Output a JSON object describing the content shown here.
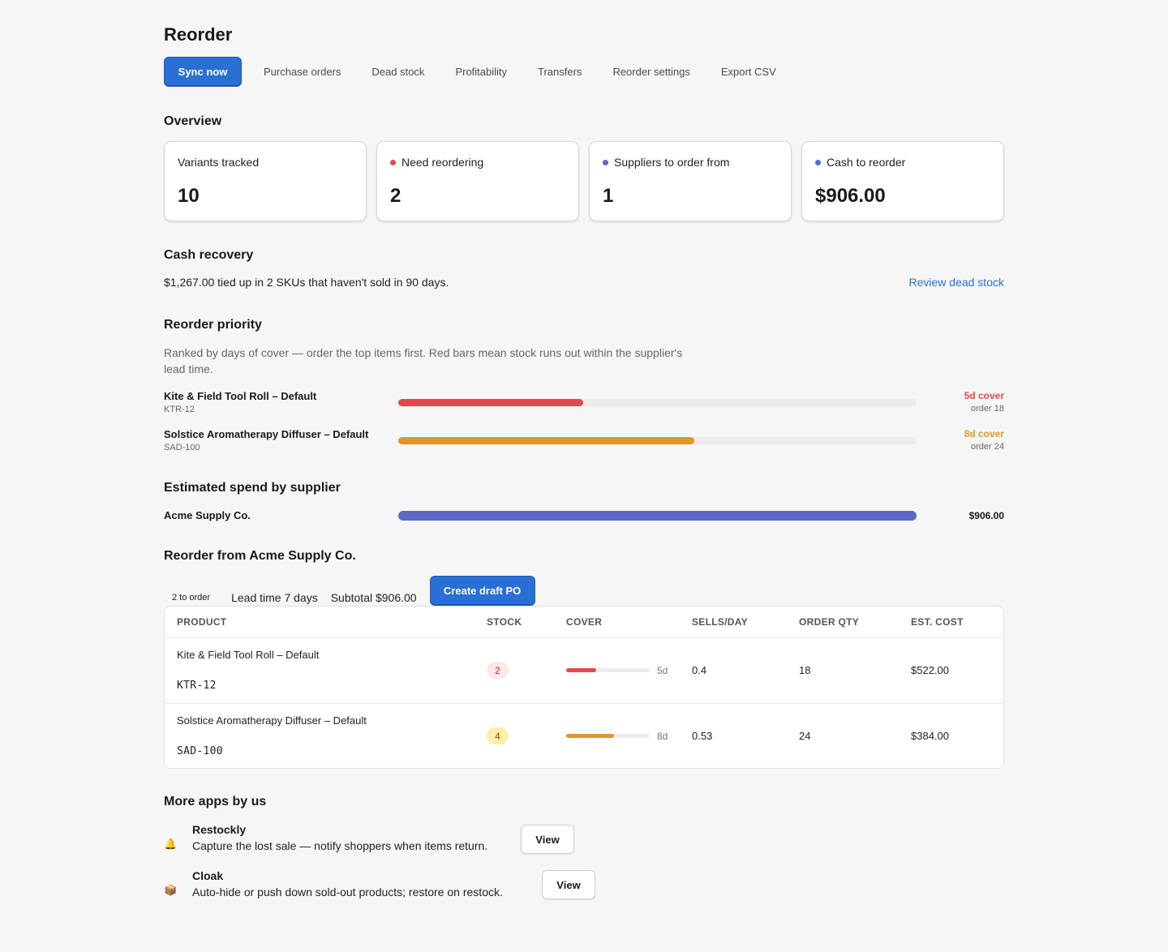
{
  "page": {
    "title": "Reorder"
  },
  "toolbar": {
    "sync_label": "Sync now",
    "tabs": [
      "Purchase orders",
      "Dead stock",
      "Profitability",
      "Transfers",
      "Reorder settings",
      "Export CSV"
    ]
  },
  "overview": {
    "heading": "Overview",
    "cards": [
      {
        "label": "Variants tracked",
        "value": "10",
        "dot": ""
      },
      {
        "label": "Need reordering",
        "value": "2",
        "dot": "#e04a4f"
      },
      {
        "label": "Suppliers to order from",
        "value": "1",
        "dot": "#5c6ac4"
      },
      {
        "label": "Cash to reorder",
        "value": "$906.00",
        "dot": "#5c6ac4"
      }
    ]
  },
  "cash_recovery": {
    "heading": "Cash recovery",
    "text": "$1,267.00 tied up in 2 SKUs that haven't sold in 90 days.",
    "link": "Review dead stock"
  },
  "priority": {
    "heading": "Reorder priority",
    "description": "Ranked by days of cover — order the top items first. Red bars mean stock runs out within the supplier's lead time.",
    "rows": [
      {
        "name": "Kite & Field Tool Roll – Default",
        "sku": "KTR-12",
        "cover": "5d cover",
        "order": "order 18",
        "fill": 0.357,
        "color": "#e04a4f"
      },
      {
        "name": "Solstice Aromatherapy Diffuser – Default",
        "sku": "SAD-100",
        "cover": "8d cover",
        "order": "order 24",
        "fill": 0.571,
        "color": "#e0962a"
      }
    ]
  },
  "spend": {
    "heading": "Estimated spend by supplier",
    "rows": [
      {
        "name": "Acme Supply Co.",
        "value": "$906.00",
        "fill": 1.0,
        "color": "#5c6ac4"
      }
    ]
  },
  "po": {
    "heading": "Reorder from Acme Supply Co.",
    "to_order": "2 to order",
    "lead_time": "Lead time 7 days",
    "subtotal": "Subtotal $906.00",
    "create_label": "Create draft PO",
    "columns": [
      "PRODUCT",
      "STOCK",
      "COVER",
      "SELLS/DAY",
      "ORDER QTY",
      "EST. COST"
    ],
    "rows": [
      {
        "product": "Kite & Field Tool Roll – Default",
        "sku": "KTR-12",
        "stock": "2",
        "stock_bg": "#fde8e8",
        "stock_fg": "#c0262d",
        "cover": "5d",
        "cover_fill": 0.357,
        "cover_color": "#e04a4f",
        "sells": "0.4",
        "qty": "18",
        "cost": "$522.00"
      },
      {
        "product": "Solstice Aromatherapy Diffuser – Default",
        "sku": "SAD-100",
        "stock": "4",
        "stock_bg": "#fdeea8",
        "stock_fg": "#7a5a00",
        "cover": "8d",
        "cover_fill": 0.571,
        "cover_color": "#e0962a",
        "sells": "0.53",
        "qty": "24",
        "cost": "$384.00"
      }
    ]
  },
  "more_apps": {
    "heading": "More apps by us",
    "apps": [
      {
        "name": "Restockly",
        "desc": "Capture the lost sale — notify shoppers when items return.",
        "icon": "bell-icon",
        "glyph": "🔔",
        "button": "View"
      },
      {
        "name": "Cloak",
        "desc": "Auto-hide or push down sold-out products; restore on restock.",
        "icon": "package-icon",
        "glyph": "📦",
        "button": "View"
      }
    ]
  }
}
